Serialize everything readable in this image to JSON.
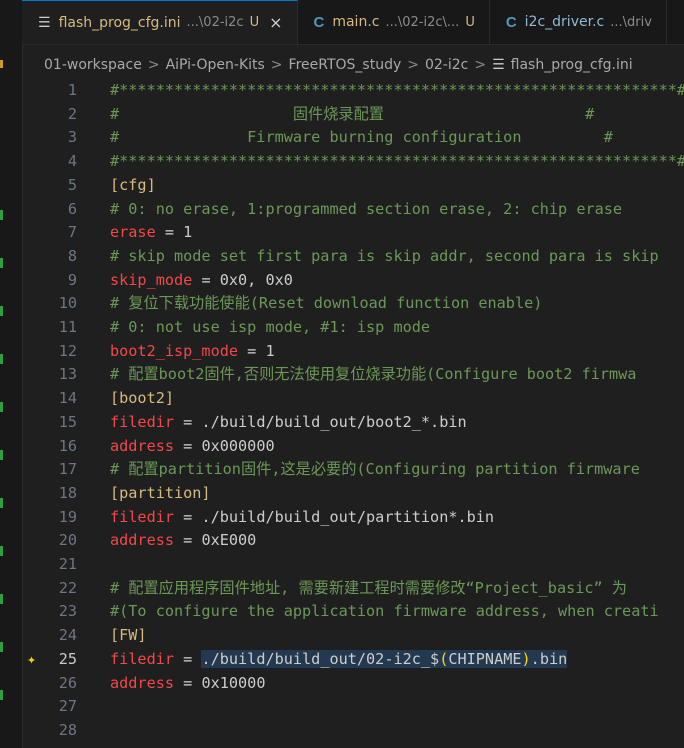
{
  "tabs": [
    {
      "icon": "lines-icon",
      "name": "flash_prog_cfg.ini",
      "path": "...\\02-i2c",
      "badge": "U",
      "close": "×",
      "active": true
    },
    {
      "icon": "c-file-icon",
      "icon_glyph": "C",
      "name": "main.c",
      "path": "...\\02-i2c\\...",
      "badge": "U",
      "active": false
    },
    {
      "icon": "c-file-icon",
      "icon_glyph": "C",
      "name": "i2c_driver.c",
      "path": "...\\driv",
      "badge": "",
      "active": false
    }
  ],
  "breadcrumb": [
    "01-workspace",
    "AiPi-Open-Kits",
    "FreeRTOS_study",
    "02-i2c",
    "flash_prog_cfg.ini"
  ],
  "breadcrumb_sep": ">",
  "editor": {
    "current_line": 25,
    "lines": [
      {
        "n": "1",
        "parts": [
          {
            "t": "#*************************************************************#",
            "c": "comment"
          }
        ]
      },
      {
        "n": "2",
        "parts": [
          {
            "t": "#                   固件烧录配置                      #",
            "c": "comment"
          }
        ]
      },
      {
        "n": "3",
        "parts": [
          {
            "t": "#              Firmware burning configuration         #",
            "c": "comment"
          }
        ]
      },
      {
        "n": "4",
        "parts": [
          {
            "t": "#*************************************************************#",
            "c": "comment"
          }
        ]
      },
      {
        "n": "5",
        "parts": [
          {
            "t": "[cfg]",
            "c": "section"
          }
        ]
      },
      {
        "n": "6",
        "parts": [
          {
            "t": "# 0: no erase, 1:programmed section erase, 2: chip erase",
            "c": "comment"
          }
        ]
      },
      {
        "n": "7",
        "parts": [
          {
            "t": "erase",
            "c": "key"
          },
          {
            "t": " = ",
            "c": "eq"
          },
          {
            "t": "1",
            "c": "val"
          }
        ]
      },
      {
        "n": "8",
        "parts": [
          {
            "t": "# skip mode set first para is skip addr, second para is skip",
            "c": "comment"
          }
        ]
      },
      {
        "n": "9",
        "parts": [
          {
            "t": "skip_mode",
            "c": "key"
          },
          {
            "t": " = ",
            "c": "eq"
          },
          {
            "t": "0x0, 0x0",
            "c": "val"
          }
        ]
      },
      {
        "n": "10",
        "parts": [
          {
            "t": "# 复位下载功能使能(Reset download function enable)",
            "c": "comment"
          }
        ]
      },
      {
        "n": "11",
        "parts": [
          {
            "t": "# 0: not use isp mode, #1: isp mode",
            "c": "comment"
          }
        ]
      },
      {
        "n": "12",
        "parts": [
          {
            "t": "boot2_isp_mode",
            "c": "key"
          },
          {
            "t": " = ",
            "c": "eq"
          },
          {
            "t": "1",
            "c": "val"
          }
        ]
      },
      {
        "n": "13",
        "parts": [
          {
            "t": "# 配置boot2固件,否则无法使用复位烧录功能(Configure boot2 firmwa",
            "c": "comment"
          }
        ]
      },
      {
        "n": "14",
        "parts": [
          {
            "t": "[boot2]",
            "c": "section"
          }
        ]
      },
      {
        "n": "15",
        "parts": [
          {
            "t": "filedir",
            "c": "key"
          },
          {
            "t": " = ",
            "c": "eq"
          },
          {
            "t": "./build/build_out/boot2_*.bin",
            "c": "val"
          }
        ]
      },
      {
        "n": "16",
        "parts": [
          {
            "t": "address",
            "c": "key"
          },
          {
            "t": " = ",
            "c": "eq"
          },
          {
            "t": "0x000000",
            "c": "val"
          }
        ]
      },
      {
        "n": "17",
        "parts": [
          {
            "t": "# 配置partition固件,这是必要的(Configuring partition firmware",
            "c": "comment"
          }
        ]
      },
      {
        "n": "18",
        "parts": [
          {
            "t": "[partition]",
            "c": "section"
          }
        ]
      },
      {
        "n": "19",
        "parts": [
          {
            "t": "filedir",
            "c": "key"
          },
          {
            "t": " = ",
            "c": "eq"
          },
          {
            "t": "./build/build_out/partition*.bin",
            "c": "val"
          }
        ]
      },
      {
        "n": "20",
        "parts": [
          {
            "t": "address",
            "c": "key"
          },
          {
            "t": " = ",
            "c": "eq"
          },
          {
            "t": "0xE000",
            "c": "val"
          }
        ]
      },
      {
        "n": "21",
        "parts": []
      },
      {
        "n": "22",
        "parts": [
          {
            "t": "# 配置应用程序固件地址, 需要新建工程时需要修改“Project_basic” 为",
            "c": "comment"
          }
        ]
      },
      {
        "n": "23",
        "parts": [
          {
            "t": "#(To configure the application firmware address, when creati",
            "c": "comment"
          }
        ]
      },
      {
        "n": "24",
        "parts": [
          {
            "t": "[FW]",
            "c": "section"
          }
        ]
      },
      {
        "n": "25",
        "parts": [
          {
            "t": "filedir",
            "c": "key"
          },
          {
            "t": " = ",
            "c": "eq"
          },
          {
            "t": "./build/build_out/02-i2c_$",
            "c": "val hl"
          },
          {
            "t": "(",
            "c": "paren hl"
          },
          {
            "t": "CHIPNAME",
            "c": "val hl"
          },
          {
            "t": ")",
            "c": "paren hl"
          },
          {
            "t": ".bin",
            "c": "val hl"
          }
        ]
      },
      {
        "n": "26",
        "parts": [
          {
            "t": "address",
            "c": "key"
          },
          {
            "t": " = ",
            "c": "eq"
          },
          {
            "t": "0x10000",
            "c": "val"
          }
        ]
      },
      {
        "n": "27",
        "parts": []
      },
      {
        "n": "28",
        "parts": []
      }
    ]
  },
  "gutter_icon": "sparkle-icon",
  "colors": {
    "comment": "#6a9955",
    "section": "#d7ba7d",
    "key": "#f44747",
    "value": "#cccccc",
    "accent": "#0078d4"
  }
}
